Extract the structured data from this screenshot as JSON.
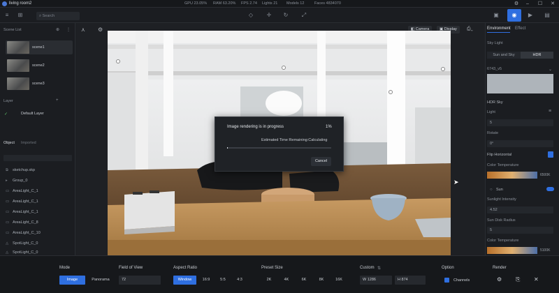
{
  "titlebar": {
    "title": "living room2",
    "stats": [
      "GPU 23.05%",
      "RAM 63.20%",
      "FPS 2.74",
      "Lights 21",
      "Models 12",
      "Faces 4834070"
    ]
  },
  "toolbar": {
    "search_placeholder": "Search"
  },
  "left": {
    "scene_list_title": "Scene List",
    "scenes": [
      "scene1",
      "scene2",
      "scene3"
    ],
    "layer_title": "Layer",
    "default_layer": "Default Layer",
    "object_tab": "Object",
    "imported_tab": "Imported",
    "objects": [
      "sketchup.skp",
      "Group_0",
      "AreaLight_C_1",
      "AreaLight_C_1",
      "AreaLight_C_1",
      "AreaLight_C_8",
      "AreaLight_C_10",
      "SpotLight_C_0",
      "SpotLight_C_0"
    ]
  },
  "viewport": {
    "camera_label": "Camera",
    "display_label": "Display"
  },
  "dialog": {
    "title": "Image rendering is in progress",
    "percent": "1%",
    "progress": 0.01,
    "eta": "Estimated Time Remaining:Calculating",
    "cancel": "Cancel"
  },
  "right": {
    "tab_environment": "Environment",
    "tab_effect": "Effect",
    "sky_light": "Sky Light",
    "sun_and_sky": "Sun and Sky",
    "hdr": "HDR",
    "hdr_file": "6743_v5",
    "hdr_sky": "HDR Sky",
    "light_label": "Light",
    "light_value": "5",
    "rotate_label": "Rotate",
    "rotate_value": "0°",
    "flip_horizontal": "Flip Horizontal",
    "color_temperature": "Color Temperature",
    "color_temp_value": "6500K",
    "sun": "Sun",
    "sunlight_intensity": "Sunlight Intensity",
    "sunlight_value": "4.52",
    "sun_disk_radius": "Sun Disk Radius",
    "sun_disk_value": "5",
    "color_temperature2": "Color Temperature",
    "color_temp_value2": "5100K"
  },
  "bottom": {
    "mode_label": "Mode",
    "mode_image": "Image",
    "mode_panorama": "Panorama",
    "fov_label": "Field of View",
    "fov_value": "72",
    "aspect_label": "Aspect Ratio",
    "aspects": [
      "Window",
      "16:9",
      "5:5",
      "4:3"
    ],
    "preset_label": "Preset Size",
    "presets": [
      "2K",
      "4K",
      "6K",
      "8K",
      "16K"
    ],
    "custom_label": "Custom",
    "w_label": "W",
    "w_value": "1286",
    "h_label": "H",
    "h_value": "874",
    "option_label": "Option",
    "channels": "Channels",
    "render_label": "Render"
  },
  "colors": {
    "accent": "#2f6fe0",
    "panel": "#1b1d21",
    "dialog": "#1f2226"
  }
}
